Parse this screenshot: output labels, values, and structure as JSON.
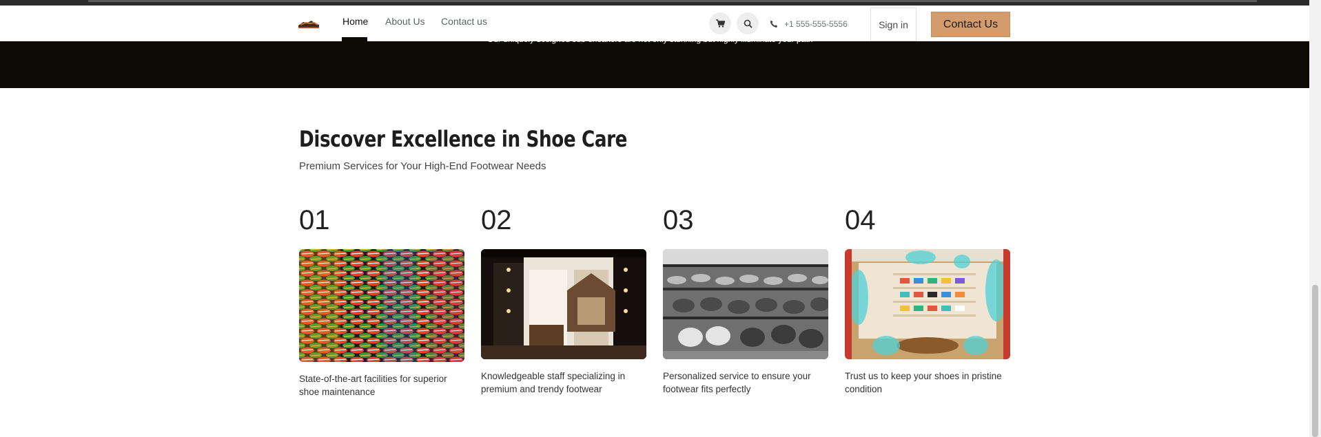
{
  "hero_band": {
    "text": "Our uniquely designed sub-sneakers are not only stunning but highly illuminate your path"
  },
  "navbar": {
    "logo_icon": "shoe-logo-icon",
    "links": [
      {
        "label": "Home",
        "active": true
      },
      {
        "label": "About Us",
        "active": false
      },
      {
        "label": "Contact us",
        "active": false
      }
    ],
    "cart_icon": "cart-icon",
    "search_icon": "search-icon",
    "phone_icon": "phone-icon",
    "phone": "+1 555-555-5556",
    "signin_label": "Sign in",
    "cta_label": "Contact Us"
  },
  "section": {
    "title": "Discover Excellence in Shoe Care",
    "subtitle": "Premium Services for Your High-End Footwear Needs",
    "cards": [
      {
        "num": "01",
        "text": "State-of-the-art facilities for superior shoe maintenance"
      },
      {
        "num": "02",
        "text": "Knowledgeable staff specializing in premium and trendy footwear"
      },
      {
        "num": "03",
        "text": "Personalized service to ensure your footwear fits perfectly"
      },
      {
        "num": "04",
        "text": "Trust us to keep your shoes in pristine condition"
      }
    ]
  },
  "colors": {
    "accent": "#d49b6c",
    "dark_band": "#0e0b07",
    "heading": "#1e1e1e"
  }
}
